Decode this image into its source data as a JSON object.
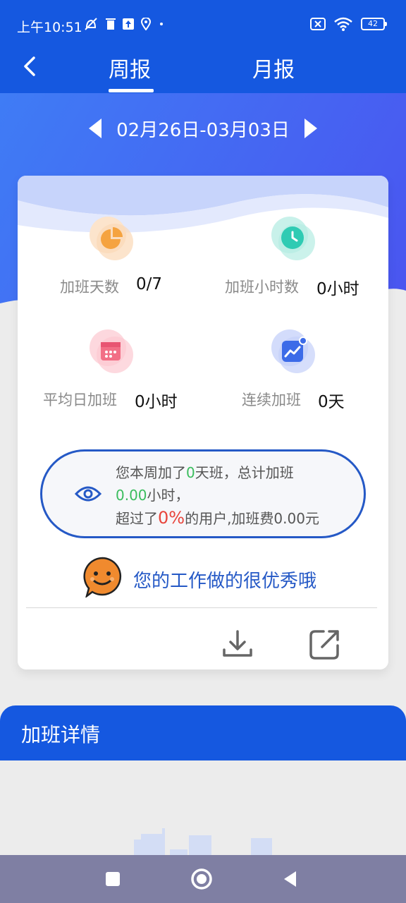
{
  "status_bar": {
    "time": "上午10:51",
    "battery": "42"
  },
  "header": {
    "tabs": [
      {
        "label": "周报"
      },
      {
        "label": "月报"
      }
    ],
    "active_tab": "周报"
  },
  "date_nav": {
    "range": "02月26日-03月03日"
  },
  "stats": [
    {
      "label": "加班天数",
      "value": "0/7",
      "icon": "pie-chart-icon",
      "color": "#f5a340"
    },
    {
      "label": "加班小时数",
      "value": "0小时",
      "icon": "clock-icon",
      "color": "#2fcbb3"
    },
    {
      "label": "平均日加班",
      "value": "0小时",
      "icon": "calendar-icon",
      "color": "#f26f86"
    },
    {
      "label": "连续加班",
      "value": "0天",
      "icon": "trend-chart-icon",
      "color": "#3c6be8"
    }
  ],
  "summary": {
    "prefix1": "您本周加了",
    "days": "0",
    "suffix1": "天班，总计加班",
    "hours": "0.00",
    "suffix2": "小时，",
    "prefix3": "超过了",
    "percent": "0%",
    "suffix3": "的用户,加班费0.00元"
  },
  "praise": {
    "text": "您的工作做的很优秀哦"
  },
  "details": {
    "title": "加班详情"
  },
  "colors": {
    "primary": "#1558e0",
    "accent_text": "#2559c6",
    "green": "#3bbd5e",
    "red": "#e8453c"
  }
}
